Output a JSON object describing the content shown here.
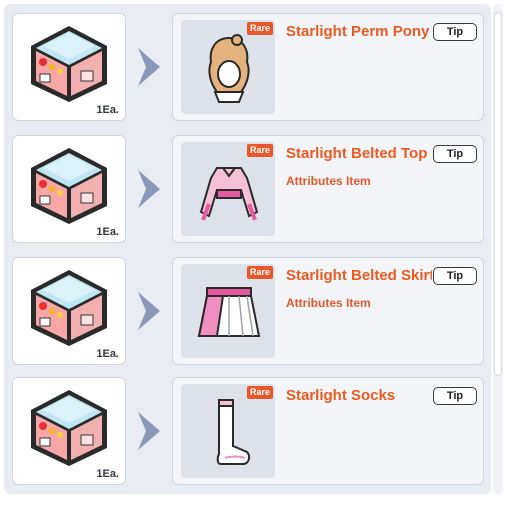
{
  "rows": [
    {
      "quantity": "1Ea.",
      "rarity": "Rare",
      "name": "Starlight Perm Pony",
      "attribute": "",
      "tip_label": "Tip",
      "box_icon": "gift-box-icon",
      "item_icon": "hairstyle-icon"
    },
    {
      "quantity": "1Ea.",
      "rarity": "Rare",
      "name": "Starlight Belted Top",
      "attribute": "Attributes Item",
      "tip_label": "Tip",
      "box_icon": "gift-box-icon",
      "item_icon": "top-icon"
    },
    {
      "quantity": "1Ea.",
      "rarity": "Rare",
      "name": "Starlight Belted Skirt",
      "attribute": "Attributes Item",
      "tip_label": "Tip",
      "box_icon": "gift-box-icon",
      "item_icon": "skirt-icon"
    },
    {
      "quantity": "1Ea.",
      "rarity": "Rare",
      "name": "Starlight Socks",
      "attribute": "",
      "tip_label": "Tip",
      "box_icon": "gift-box-icon",
      "item_icon": "socks-icon"
    }
  ],
  "colors": {
    "accent": "#ee5a1f",
    "rare_badge": "#e8572a",
    "panel_bg": "#e9edf3",
    "arrow": "#8b97b8"
  }
}
